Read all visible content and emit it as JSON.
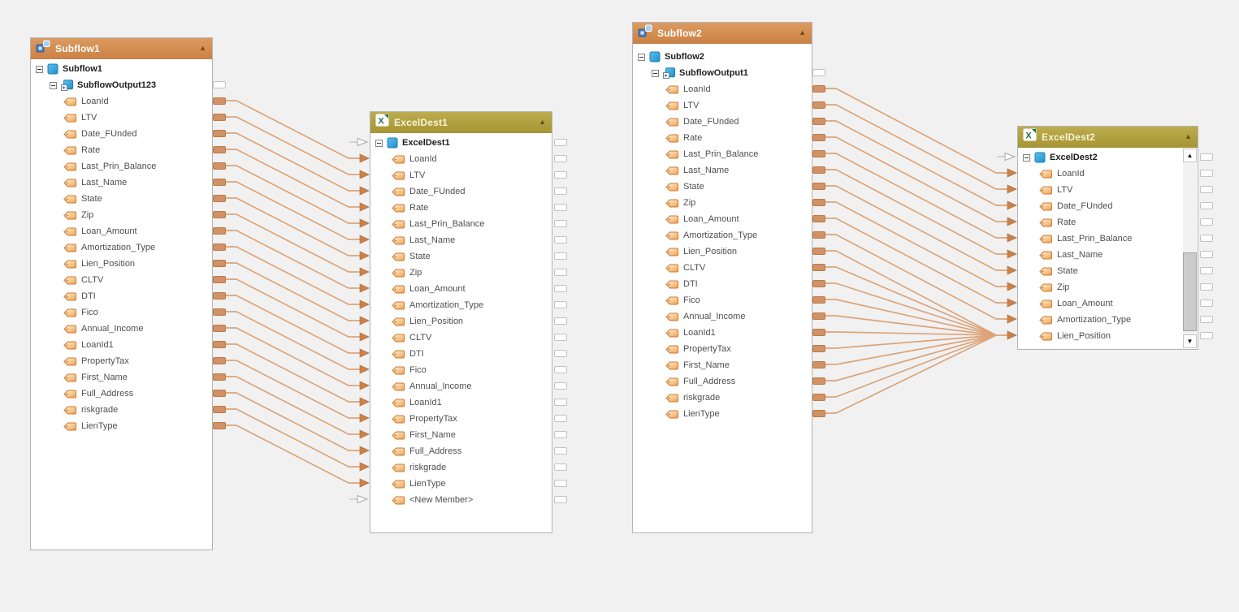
{
  "icons": {
    "collapse": "▲",
    "scroll_up": "▲",
    "scroll_down": "▼"
  },
  "colors": {
    "canvas_bg": "#f1f1f2",
    "subflow_header": "#d28a4e",
    "excel_header": "#b2a140",
    "connector": "#dca478",
    "arrowhead": "#c8824c",
    "port_fill": "#d09266",
    "tag_icon": "#f2ad62",
    "tree_object_blue": "#2ba1dd",
    "excel_green": "#217346"
  },
  "nodes": [
    {
      "id": "subflow1",
      "kind": "subflow",
      "title": "Subflow1",
      "root_label": "Subflow1",
      "output_label": "SubflowOutput123",
      "fields": [
        "LoanId",
        "LTV",
        "Date_FUnded",
        "Rate",
        "Last_Prin_Balance",
        "Last_Name",
        "State",
        "Zip",
        "Loan_Amount",
        "Amortization_Type",
        "Lien_Position",
        "CLTV",
        "DTI",
        "Fico",
        "Annual_Income",
        "LoanId1",
        "PropertyTax",
        "First_Name",
        "Full_Address",
        "riskgrade",
        "LienType"
      ]
    },
    {
      "id": "exceldest1",
      "kind": "excel",
      "title": "ExcelDest1",
      "root_label": "ExcelDest1",
      "fields": [
        "LoanId",
        "LTV",
        "Date_FUnded",
        "Rate",
        "Last_Prin_Balance",
        "Last_Name",
        "State",
        "Zip",
        "Loan_Amount",
        "Amortization_Type",
        "Lien_Position",
        "CLTV",
        "DTI",
        "Fico",
        "Annual_Income",
        "LoanId1",
        "PropertyTax",
        "First_Name",
        "Full_Address",
        "riskgrade",
        "LienType",
        "<New Member>"
      ]
    },
    {
      "id": "subflow2",
      "kind": "subflow",
      "title": "Subflow2",
      "root_label": "Subflow2",
      "output_label": "SubflowOutput1",
      "fields": [
        "LoanId",
        "LTV",
        "Date_FUnded",
        "Rate",
        "Last_Prin_Balance",
        "Last_Name",
        "State",
        "Zip",
        "Loan_Amount",
        "Amortization_Type",
        "Lien_Position",
        "CLTV",
        "DTI",
        "Fico",
        "Annual_Income",
        "LoanId1",
        "PropertyTax",
        "First_Name",
        "Full_Address",
        "riskgrade",
        "LienType"
      ]
    },
    {
      "id": "exceldest2",
      "kind": "excel",
      "title": "ExcelDest2",
      "root_label": "ExcelDest2",
      "fields": [
        "LoanId",
        "LTV",
        "Date_FUnded",
        "Rate",
        "Last_Prin_Balance",
        "Last_Name",
        "State",
        "Zip",
        "Loan_Amount",
        "Amortization_Type",
        "Lien_Position"
      ],
      "scrolled": true
    }
  ],
  "connections": [
    {
      "source_node": "Subflow1",
      "source_tree": "SubflowOutput123",
      "target_node": "ExcelDest1",
      "mapping": "all 21 fields mapped by name"
    },
    {
      "source_node": "Subflow2",
      "source_tree": "SubflowOutput1",
      "target_node": "ExcelDest2",
      "mapping": "all 21 fields mapped by name; targets scrolled out of view converge at Lien_Position row"
    }
  ]
}
